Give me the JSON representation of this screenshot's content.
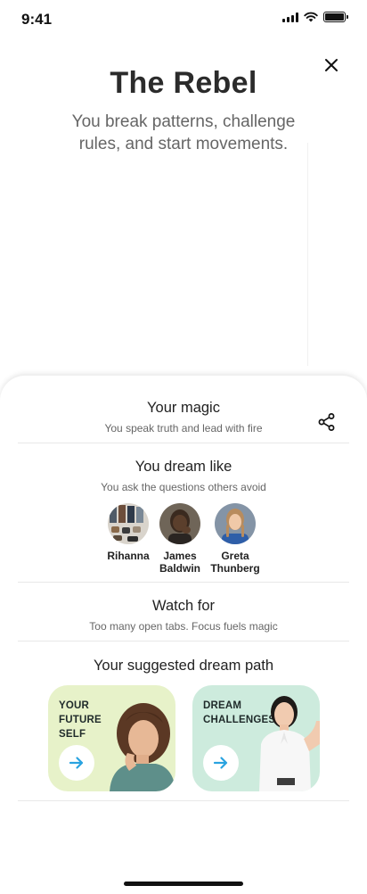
{
  "status_bar": {
    "time": "9:41"
  },
  "hero": {
    "title": "The Rebel",
    "subtitle": "You break patterns, challenge rules, and start movements."
  },
  "sections": {
    "magic": {
      "title": "Your magic",
      "subtitle": "You speak truth and lead with fire"
    },
    "dream_like": {
      "title": "You dream like",
      "subtitle": "You ask the questions others avoid",
      "people": [
        {
          "name": "Rihanna"
        },
        {
          "name": "James Baldwin"
        },
        {
          "name": "Greta Thunberg"
        }
      ]
    },
    "watch_for": {
      "title": "Watch for",
      "subtitle": "Too many open tabs. Focus fuels magic"
    },
    "dream_path": {
      "title": "Your suggested dream path",
      "cards": [
        {
          "label": "YOUR FUTURE SELF",
          "color": "#e7f2c9"
        },
        {
          "label": "DREAM CHALLENGES",
          "color": "#cdebdd"
        }
      ]
    }
  },
  "colors": {
    "accent_arrow": "#2aa3e0"
  }
}
